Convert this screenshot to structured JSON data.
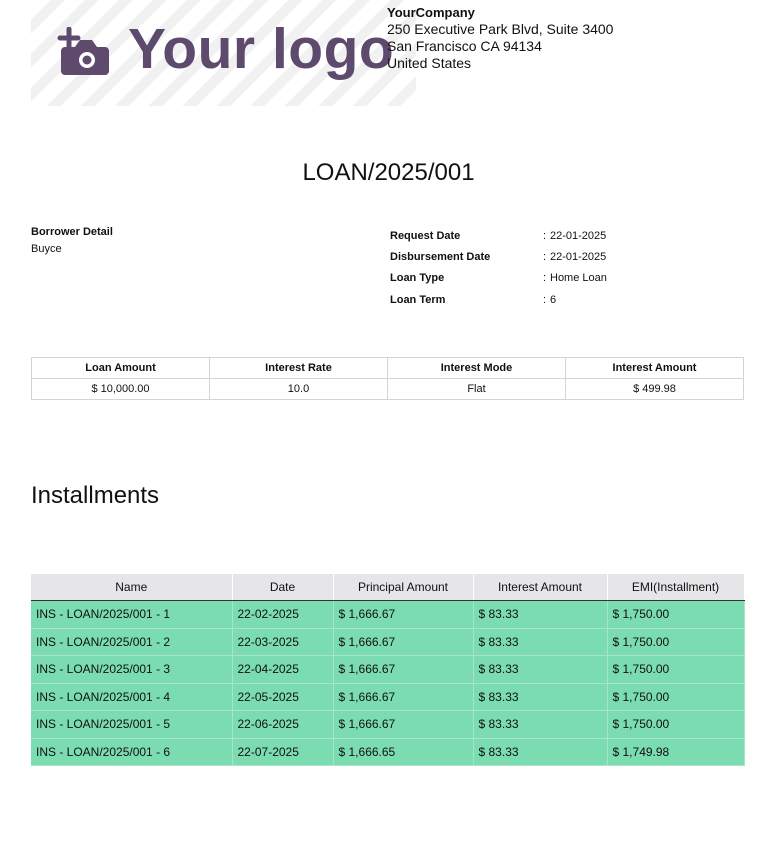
{
  "logo": {
    "text": "Your logo",
    "icon": "camera-plus-icon",
    "color": "#5d4a6d"
  },
  "company": {
    "name": "YourCompany",
    "address_line1": "250 Executive Park Blvd, Suite 3400",
    "address_line2": "San Francisco CA 94134",
    "country": "United States"
  },
  "title": "LOAN/2025/001",
  "borrower": {
    "label": "Borrower Detail",
    "name": "Buyce"
  },
  "details": [
    {
      "label": "Request Date",
      "value": "22-01-2025"
    },
    {
      "label": "Disbursement Date",
      "value": "22-01-2025"
    },
    {
      "label": "Loan Type",
      "value": "Home Loan"
    },
    {
      "label": "Loan Term",
      "value": "6"
    }
  ],
  "details_separator": ":",
  "summary": {
    "headers": [
      "Loan Amount",
      "Interest Rate",
      "Interest Mode",
      "Interest Amount"
    ],
    "values": [
      "$ 10,000.00",
      "10.0",
      "Flat",
      "$ 499.98"
    ]
  },
  "installments": {
    "title": "Installments",
    "row_color": "#7adcb0",
    "headers": [
      "Name",
      "Date",
      "Principal Amount",
      "Interest Amount",
      "EMI(Installment)"
    ],
    "rows": [
      [
        "INS - LOAN/2025/001 - 1",
        "22-02-2025",
        "$ 1,666.67",
        "$ 83.33",
        "$ 1,750.00"
      ],
      [
        "INS - LOAN/2025/001 - 2",
        "22-03-2025",
        "$ 1,666.67",
        "$ 83.33",
        "$ 1,750.00"
      ],
      [
        "INS - LOAN/2025/001 - 3",
        "22-04-2025",
        "$ 1,666.67",
        "$ 83.33",
        "$ 1,750.00"
      ],
      [
        "INS - LOAN/2025/001 - 4",
        "22-05-2025",
        "$ 1,666.67",
        "$ 83.33",
        "$ 1,750.00"
      ],
      [
        "INS - LOAN/2025/001 - 5",
        "22-06-2025",
        "$ 1,666.67",
        "$ 83.33",
        "$ 1,750.00"
      ],
      [
        "INS - LOAN/2025/001 - 6",
        "22-07-2025",
        "$ 1,666.65",
        "$ 83.33",
        "$ 1,749.98"
      ]
    ]
  }
}
